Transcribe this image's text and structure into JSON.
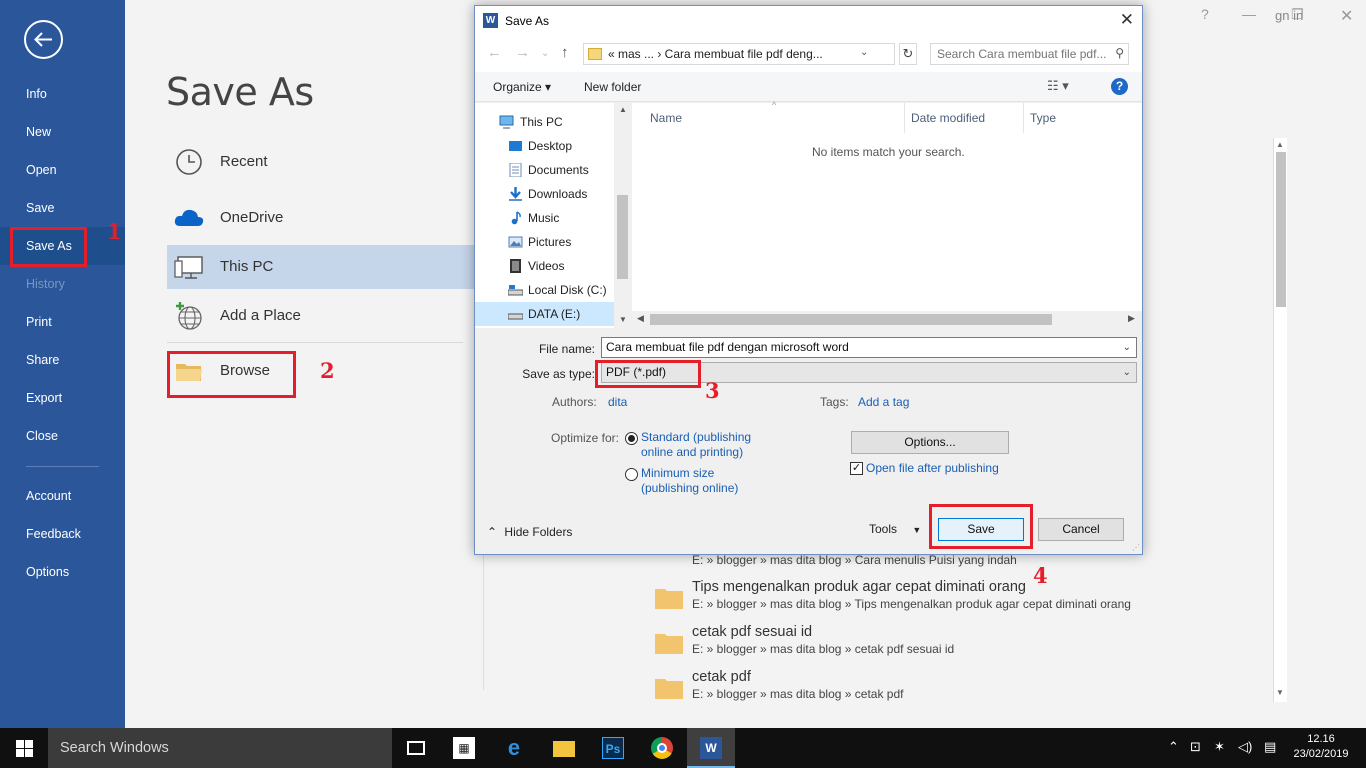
{
  "sidebar": {
    "items": [
      {
        "label": "Info"
      },
      {
        "label": "New"
      },
      {
        "label": "Open"
      },
      {
        "label": "Save"
      },
      {
        "label": "Save As"
      },
      {
        "label": "History"
      },
      {
        "label": "Print"
      },
      {
        "label": "Share"
      },
      {
        "label": "Export"
      },
      {
        "label": "Close"
      },
      {
        "label": "Account"
      },
      {
        "label": "Feedback"
      },
      {
        "label": "Options"
      }
    ]
  },
  "main": {
    "title": "Save As",
    "locations": [
      {
        "label": "Recent",
        "icon": "clock-icon"
      },
      {
        "label": "OneDrive",
        "icon": "cloud-icon"
      },
      {
        "label": "This PC",
        "icon": "computer-icon"
      },
      {
        "label": "Add a Place",
        "icon": "globe-add-icon"
      },
      {
        "label": "Browse",
        "icon": "folder-icon"
      }
    ],
    "signin_partial": "gn in",
    "recent_folders": [
      {
        "name": "",
        "path": "E: » blogger » mas dita blog » Cara menulis Puisi yang indah"
      },
      {
        "name": "Tips mengenalkan produk agar cepat diminati orang",
        "path": "E: » blogger » mas dita blog » Tips mengenalkan produk agar cepat diminati orang"
      },
      {
        "name": "cetak pdf sesuai id",
        "path": "E: » blogger » mas dita blog » cetak pdf sesuai id"
      },
      {
        "name": "cetak pdf",
        "path": "E: » blogger » mas dita blog » cetak pdf"
      }
    ]
  },
  "dialog": {
    "title": "Save As",
    "address": "«  mas ...  ›  Cara membuat file pdf deng...",
    "search_placeholder": "Search Cara membuat file pdf...",
    "toolbar": {
      "organize": "Organize ▾",
      "new_folder": "New folder"
    },
    "tree": [
      {
        "label": "This PC",
        "icon": "computer-icon"
      },
      {
        "label": "Desktop",
        "icon": "desktop-icon"
      },
      {
        "label": "Documents",
        "icon": "documents-icon"
      },
      {
        "label": "Downloads",
        "icon": "downloads-icon"
      },
      {
        "label": "Music",
        "icon": "music-icon"
      },
      {
        "label": "Pictures",
        "icon": "pictures-icon"
      },
      {
        "label": "Videos",
        "icon": "videos-icon"
      },
      {
        "label": "Local Disk (C:)",
        "icon": "drive-icon"
      },
      {
        "label": "DATA (E:)",
        "icon": "drive-icon"
      }
    ],
    "columns": {
      "name": "Name",
      "date": "Date modified",
      "type": "Type"
    },
    "empty_text": "No items match your search.",
    "file_name_label": "File name:",
    "file_name_value": "Cara membuat file pdf dengan microsoft word",
    "save_type_label": "Save as type:",
    "save_type_value": "PDF (*.pdf)",
    "authors_label": "Authors:",
    "authors_value": "dita",
    "tags_label": "Tags:",
    "tags_value": "Add a tag",
    "optimize_label": "Optimize for:",
    "optimize_standard": "Standard (publishing online and printing)",
    "optimize_minimum": "Minimum size (publishing online)",
    "options_button": "Options...",
    "open_after_label": "Open file after publishing",
    "hide_folders": "Hide Folders",
    "tools_label": "Tools",
    "save_button": "Save",
    "cancel_button": "Cancel"
  },
  "annotations": {
    "n1": "1",
    "n2": "2",
    "n3": "3",
    "n4": "4"
  },
  "taskbar": {
    "search_text": "Search Windows",
    "time": "12.16",
    "date": "23/02/2019"
  },
  "colors": {
    "word_blue": "#2b579a",
    "annotation_red": "#e41e2a",
    "link_blue": "#1a5fb4"
  }
}
